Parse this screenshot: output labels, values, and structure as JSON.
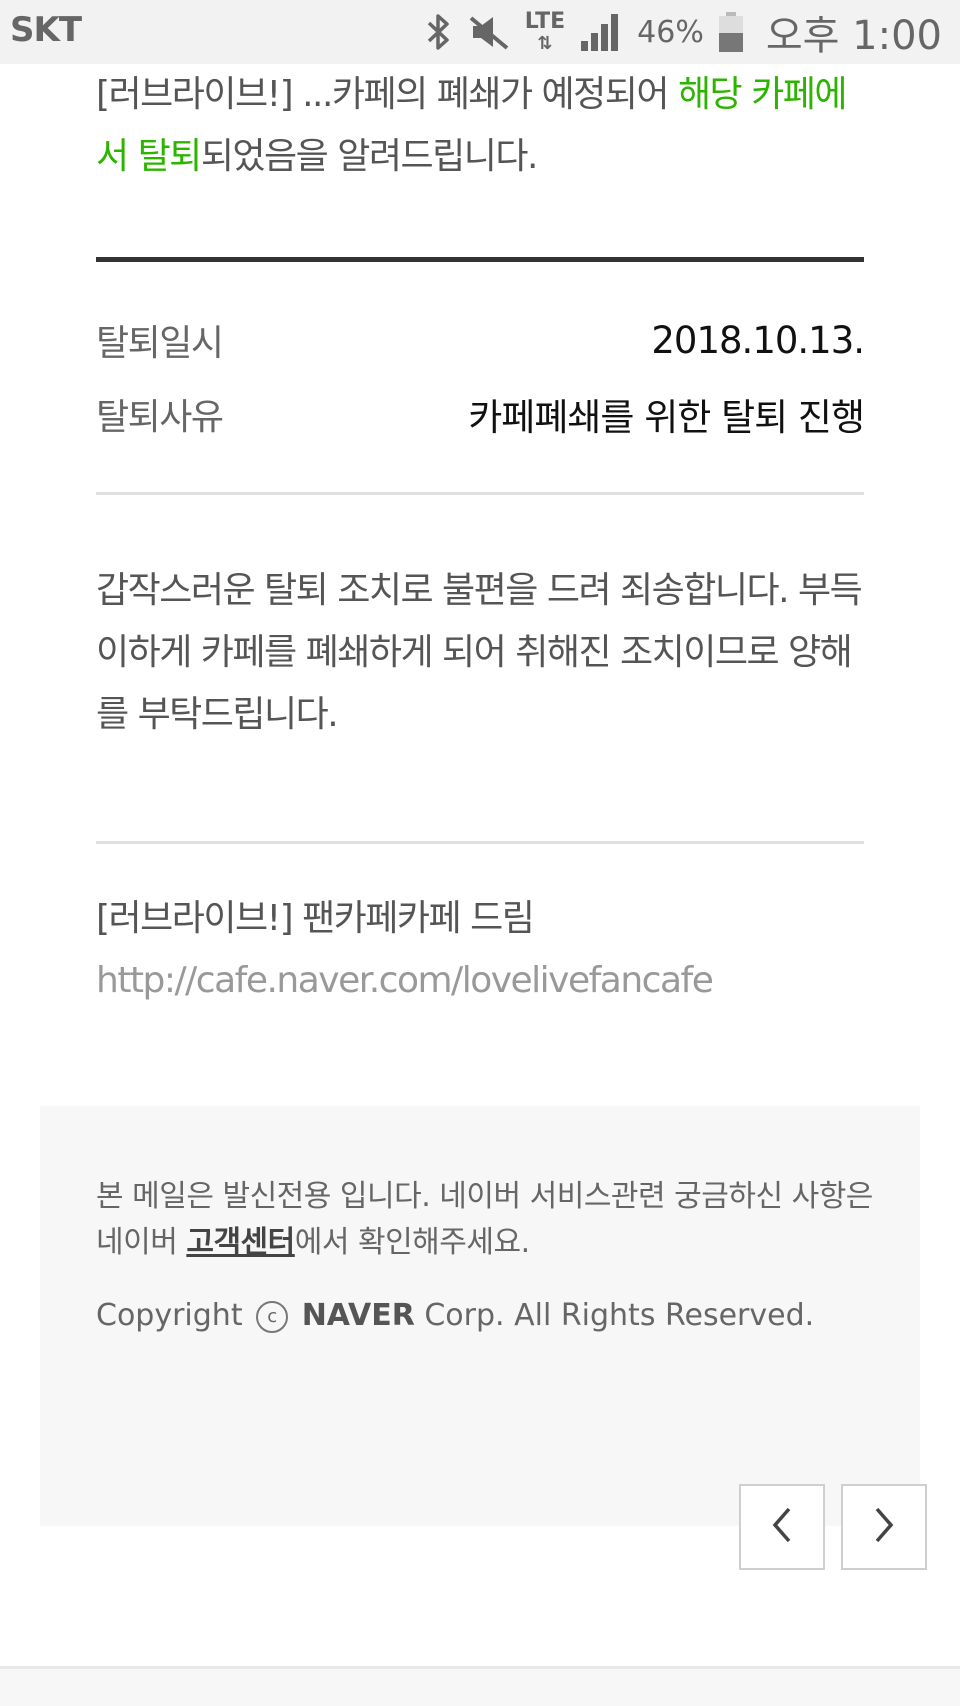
{
  "status_bar": {
    "carrier": "SKT",
    "network": "LTE",
    "network_arrows": "⇅",
    "battery_percent": "46%",
    "time": "오후 1:00"
  },
  "intro": {
    "part1": "[러브라이브!] ...카페의 폐쇄가 예정되어 ",
    "highlight": "해당 카페에서 탈퇴",
    "part2": "되었음을 알려드립니다."
  },
  "details": [
    {
      "label": "탈퇴일시",
      "value": "2018.10.13."
    },
    {
      "label": "탈퇴사유",
      "value": "카페폐쇄를 위한 탈퇴 진행"
    }
  ],
  "apology": "갑작스러운 탈퇴 조치로 불편을 드려 죄송합니다. 부득이하게 카페를 폐쇄하게 되어 취해진 조치이므로 양해를 부탁드립니다.",
  "signature": {
    "name": "[러브라이브!] 팬카페카페 드림",
    "url": "http://cafe.naver.com/lovelivefancafe"
  },
  "footer": {
    "notice_pre": "본 메일은 발신전용 입니다. 네이버 서비스관련 궁금하신 사항은 네이버 ",
    "notice_link": "고객센터",
    "notice_post": "에서 확인해주세요.",
    "copyright_pre": "Copyright",
    "copyright_symbol": "c",
    "copyright_brand": "NAVER",
    "copyright_post": "Corp. All Rights Reserved."
  },
  "colors": {
    "accent_green": "#2db400",
    "text": "#555555"
  },
  "icons": {
    "bluetooth": "bluetooth-icon",
    "mute": "mute-icon",
    "signal": "signal-icon",
    "battery": "battery-icon",
    "prev": "chevron-left-icon",
    "next": "chevron-right-icon"
  }
}
